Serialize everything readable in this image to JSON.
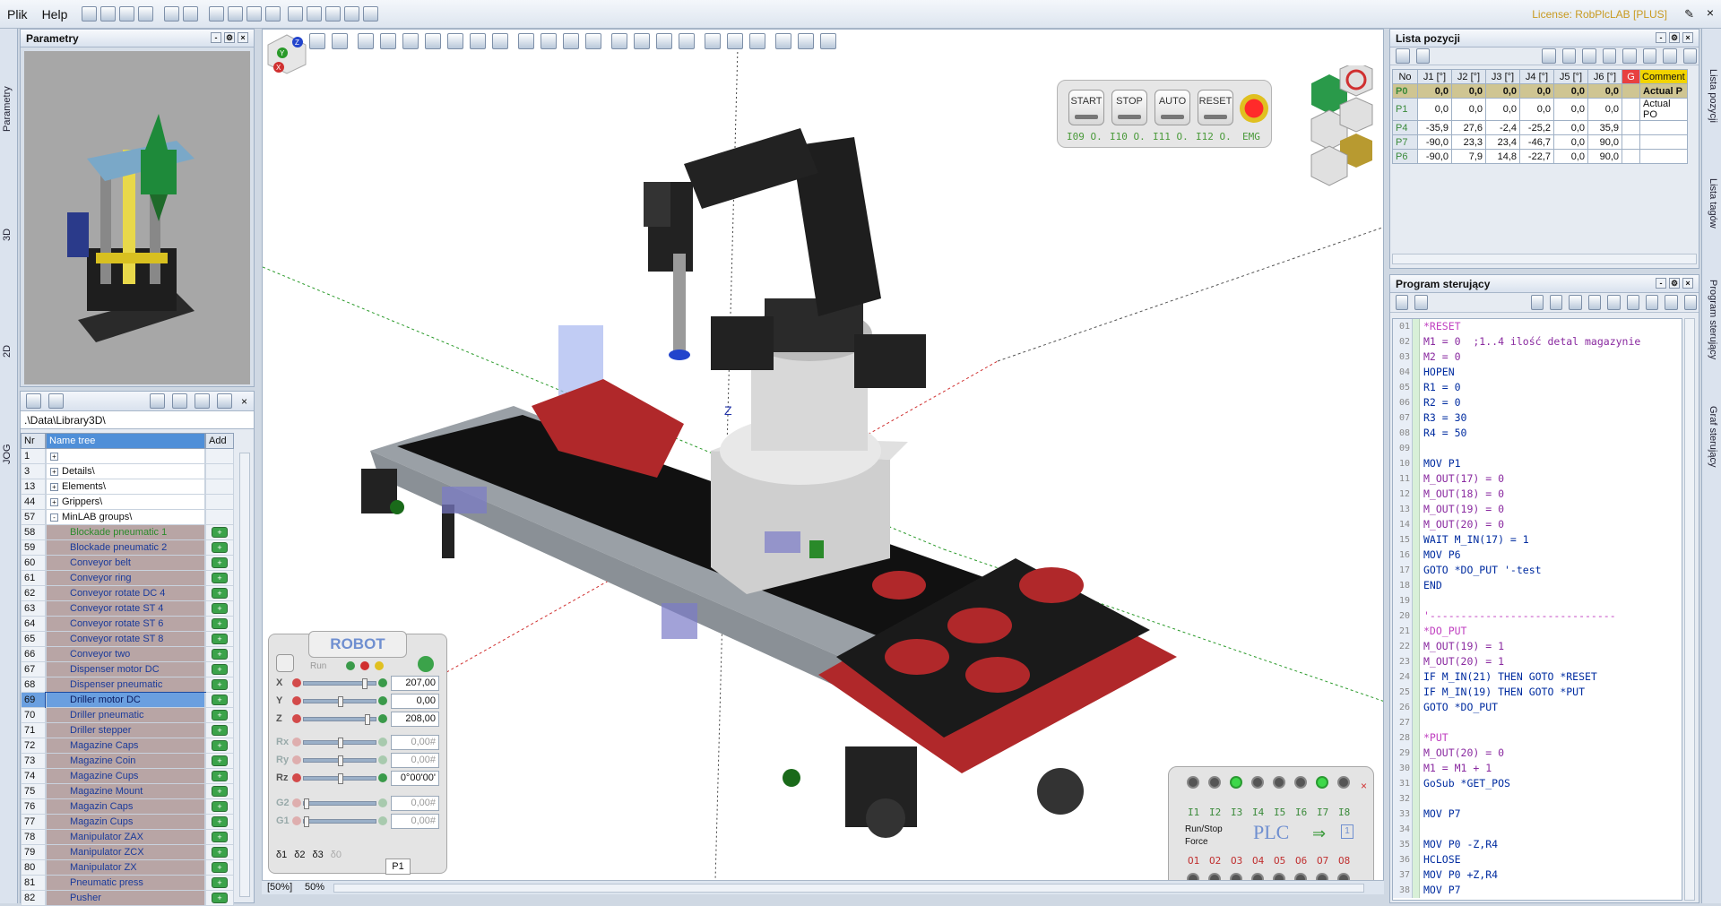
{
  "menu": {
    "file": "Plik",
    "help": "Help"
  },
  "license": "License: RobPlcLAB [PLUS]",
  "left_tabs": [
    "Parametry",
    "3D",
    "2D",
    "JOG"
  ],
  "param_panel": {
    "title": "Parametry"
  },
  "library": {
    "path": ".\\Data\\Library3D\\",
    "col_nr": "Nr",
    "col_name": "Name tree",
    "col_add": "Add",
    "rows": [
      {
        "nr": "1",
        "name": "",
        "kind": "folder"
      },
      {
        "nr": "3",
        "name": "Details\\",
        "kind": "folder"
      },
      {
        "nr": "13",
        "name": "Elements\\",
        "kind": "folder"
      },
      {
        "nr": "44",
        "name": "Grippers\\",
        "kind": "folder"
      },
      {
        "nr": "57",
        "name": "MinLAB groups\\",
        "kind": "open"
      },
      {
        "nr": "58",
        "name": "Blockade pneumatic 1",
        "kind": "item"
      },
      {
        "nr": "59",
        "name": "Blockade pneumatic 2",
        "kind": "item"
      },
      {
        "nr": "60",
        "name": "Conveyor belt",
        "kind": "item"
      },
      {
        "nr": "61",
        "name": "Conveyor ring",
        "kind": "item"
      },
      {
        "nr": "62",
        "name": "Conveyor rotate DC 4",
        "kind": "item"
      },
      {
        "nr": "63",
        "name": "Conveyor rotate ST 4",
        "kind": "item"
      },
      {
        "nr": "64",
        "name": "Conveyor rotate ST 6",
        "kind": "item"
      },
      {
        "nr": "65",
        "name": "Conveyor rotate ST 8",
        "kind": "item"
      },
      {
        "nr": "66",
        "name": "Conveyor two",
        "kind": "item"
      },
      {
        "nr": "67",
        "name": "Dispenser motor DC",
        "kind": "item"
      },
      {
        "nr": "68",
        "name": "Dispenser pneumatic",
        "kind": "item"
      },
      {
        "nr": "69",
        "name": "Driller motor DC",
        "kind": "sel"
      },
      {
        "nr": "70",
        "name": "Driller pneumatic",
        "kind": "item"
      },
      {
        "nr": "71",
        "name": "Driller stepper",
        "kind": "item"
      },
      {
        "nr": "72",
        "name": "Magazine Caps",
        "kind": "item"
      },
      {
        "nr": "73",
        "name": "Magazine Coin",
        "kind": "item"
      },
      {
        "nr": "74",
        "name": "Magazine Cups",
        "kind": "item"
      },
      {
        "nr": "75",
        "name": "Magazine Mount",
        "kind": "item"
      },
      {
        "nr": "76",
        "name": "Magazin Caps",
        "kind": "item"
      },
      {
        "nr": "77",
        "name": "Magazin Cups",
        "kind": "item"
      },
      {
        "nr": "78",
        "name": "Manipulator ZAX",
        "kind": "item"
      },
      {
        "nr": "79",
        "name": "Manipulator ZCX",
        "kind": "item"
      },
      {
        "nr": "80",
        "name": "Manipulator ZX",
        "kind": "item"
      },
      {
        "nr": "81",
        "name": "Pneumatic press",
        "kind": "item"
      },
      {
        "nr": "82",
        "name": "Pusher",
        "kind": "item"
      }
    ]
  },
  "control": {
    "start": "START",
    "stop": "STOP",
    "auto": "AUTO",
    "reset": "RESET",
    "io": [
      "I09 O.",
      "I10 O.",
      "I11 O.",
      "I12 O.",
      "EMG"
    ]
  },
  "robot": {
    "title": "ROBOT",
    "run": "Run",
    "axes": [
      {
        "ax": "X",
        "val": "207,00",
        "level": 0.85,
        "dim": false
      },
      {
        "ax": "Y",
        "val": "0,00",
        "level": 0.5,
        "dim": false
      },
      {
        "ax": "Z",
        "val": "208,00",
        "level": 0.9,
        "dim": false
      },
      {
        "ax": "Rx",
        "val": "0,00#",
        "level": 0.5,
        "dim": true
      },
      {
        "ax": "Ry",
        "val": "0,00#",
        "level": 0.5,
        "dim": true
      },
      {
        "ax": "Rz",
        "val": "0°00'00'",
        "level": 0.5,
        "dim": false
      },
      {
        "ax": "G2",
        "val": "0,00#",
        "level": 0.0,
        "dim": true
      },
      {
        "ax": "G1",
        "val": "0,00#",
        "level": 0.0,
        "dim": true
      }
    ],
    "checks": [
      "δ1",
      "δ2",
      "δ3",
      "δ0"
    ],
    "point": "P1"
  },
  "plc": {
    "title": "PLC",
    "inputs": [
      "I1",
      "I2",
      "I3",
      "I4",
      "I5",
      "I6",
      "I7",
      "I8"
    ],
    "outputs": [
      "O1",
      "O2",
      "O3",
      "O4",
      "O5",
      "O6",
      "O7",
      "O8"
    ],
    "inputs_on": [
      false,
      false,
      true,
      false,
      false,
      false,
      true,
      false
    ],
    "run_stop": "Run/Stop",
    "force": "Force",
    "counter": "1"
  },
  "status": {
    "zoom1": "[50%]",
    "zoom2": "50%"
  },
  "positions": {
    "title": "Lista pozycji",
    "headers": [
      "No",
      "J1 [°]",
      "J2 [°]",
      "J3 [°]",
      "J4 [°]",
      "J5 [°]",
      "J6 [°]",
      "G",
      "Comment"
    ],
    "rows": [
      {
        "no": "P0",
        "v": [
          "0,0",
          "0,0",
          "0,0",
          "0,0",
          "0,0",
          "0,0"
        ],
        "cm": "Actual P",
        "active": true
      },
      {
        "no": "P1",
        "v": [
          "0,0",
          "0,0",
          "0,0",
          "0,0",
          "0,0",
          "0,0"
        ],
        "cm": "Actual PO",
        "active": false
      },
      {
        "no": "P4",
        "v": [
          "-35,9",
          "27,6",
          "-2,4",
          "-25,2",
          "0,0",
          "35,9"
        ],
        "cm": "",
        "active": false
      },
      {
        "no": "P7",
        "v": [
          "-90,0",
          "23,3",
          "23,4",
          "-46,7",
          "0,0",
          "90,0"
        ],
        "cm": "",
        "active": false
      },
      {
        "no": "P6",
        "v": [
          "-90,0",
          "7,9",
          "14,8",
          "-22,7",
          "0,0",
          "90,0"
        ],
        "cm": "",
        "active": false
      }
    ]
  },
  "program": {
    "title": "Program sterujący",
    "lines": [
      "*RESET",
      "M1 = 0  ;1..4 ilość detal magazynie",
      "M2 = 0",
      "HOPEN",
      "R1 = 0",
      "R2 = 0",
      "R3 = 30",
      "R4 = 50",
      "",
      "MOV P1",
      "M_OUT(17) = 0",
      "M_OUT(18) = 0",
      "M_OUT(19) = 0",
      "M_OUT(20) = 0",
      "WAIT M_IN(17) = 1",
      "MOV P6",
      "GOTO *DO_PUT '-test",
      "END",
      "",
      "'------------------------------",
      "*DO_PUT",
      "M_OUT(19) = 1",
      "M_OUT(20) = 1",
      "IF M_IN(21) THEN GOTO *RESET",
      "IF M_IN(19) THEN GOTO *PUT",
      "GOTO *DO_PUT",
      "",
      "*PUT",
      "M_OUT(20) = 0",
      "M1 = M1 + 1",
      "GoSub *GET_POS",
      "",
      "MOV P7",
      "",
      "MOV P0 -Z,R4",
      "HCLOSE",
      "MOV P0 +Z,R4",
      "MOV P7"
    ]
  },
  "right_tabs": [
    "Lista pozycji",
    "Lista tagów",
    "Program sterujący",
    "Graf sterujący"
  ]
}
